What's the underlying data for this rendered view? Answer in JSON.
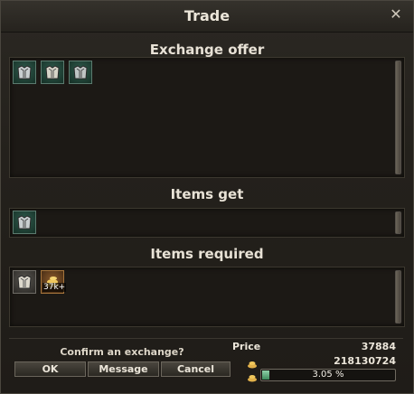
{
  "window": {
    "title": "Trade"
  },
  "sections": {
    "exchange_offer": "Exchange offer",
    "items_get": "Items get",
    "items_required": "Items required"
  },
  "exchange_offer_items": [
    {
      "icon": "armor-icon",
      "style": "teal"
    },
    {
      "icon": "armor-icon",
      "style": "teal"
    },
    {
      "icon": "armor-icon",
      "style": "teal"
    }
  ],
  "items_get_items": [
    {
      "icon": "armor-icon",
      "style": "teal"
    }
  ],
  "items_required_items": [
    {
      "icon": "armor-icon",
      "style": "grey"
    },
    {
      "icon": "gold-coins-icon",
      "style": "gold",
      "badge": "37k+"
    }
  ],
  "footer": {
    "confirm_text": "Confirm an exchange?",
    "ok_label": "OK",
    "message_label": "Message",
    "cancel_label": "Cancel",
    "price_label": "Price",
    "price_value": "37884",
    "balance_value": "218130724",
    "progress_text": "3.05 %",
    "progress_fraction": 0.0305
  },
  "colors": {
    "accent_green": "#3d8a5c",
    "gold": "#a6753c",
    "text": "#ece6da"
  }
}
